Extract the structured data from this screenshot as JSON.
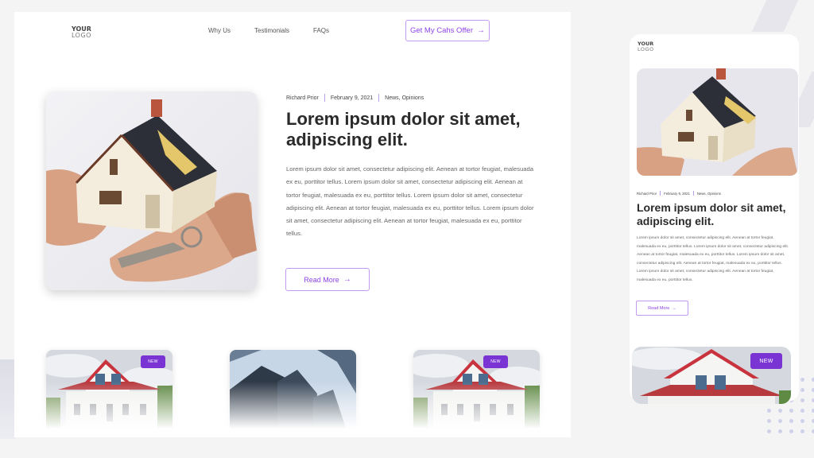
{
  "logo": {
    "line1": "YOUR",
    "line2": "LOGO"
  },
  "nav": {
    "items": [
      "Why Us",
      "Testimonials",
      "FAQs"
    ],
    "cta_label": "Get My Cahs Offer",
    "cta_icon": "arrow-right-icon"
  },
  "article": {
    "author": "Richard Prior",
    "date": "February 9, 2021",
    "categories": "News, Opinions",
    "title": "Lorem ipsum dolor sit amet, adipiscing elit.",
    "body": "Lorem ipsum dolor sit amet, consectetur adipiscing elit. Aenean at tortor feugiat, malesuada ex eu, porttitor tellus. Lorem ipsum dolor sit amet, consectetur adipiscing elit. Aenean at tortor feugiat, malesuada ex eu, porttitor tellus. Lorem ipsum dolor sit amet, consectetur adipiscing elit. Aenean at tortor feugiat, malesuada ex eu, porttitor tellus. Lorem ipsum dolor sit amet, consectetur adipiscing elit. Aenean at tortor feugiat, malesuada ex eu, porttitor tellus.",
    "read_more_label": "Read More",
    "hero_image": "house-model-in-hands-with-keys"
  },
  "cards": [
    {
      "image": "white-house-red-roof",
      "badge": "NEW"
    },
    {
      "image": "skyscrapers-from-below",
      "badge": null
    },
    {
      "image": "white-house-red-roof",
      "badge": "NEW"
    }
  ],
  "mobile": {
    "card_badge": "NEW"
  },
  "colors": {
    "accent": "#8e44e6",
    "accent_border": "#c39bf2",
    "badge": "#7a34d4",
    "background": "#f4f4f5"
  }
}
